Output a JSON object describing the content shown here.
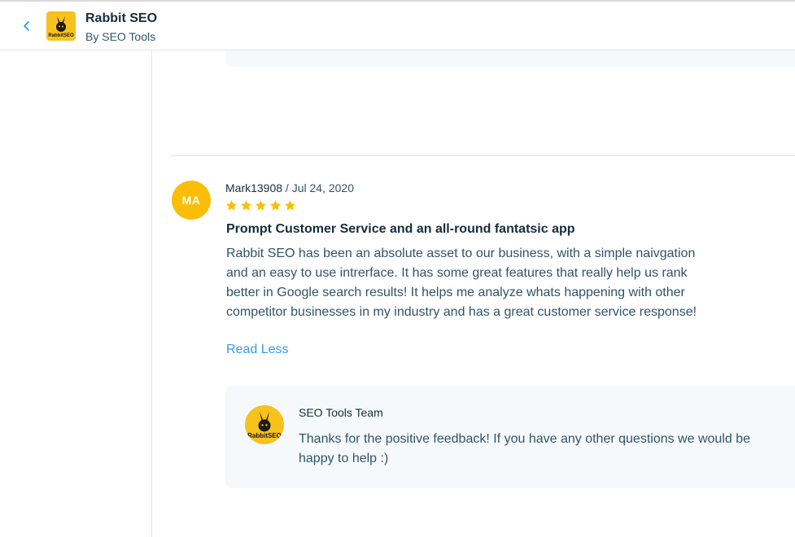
{
  "header": {
    "app_name": "Rabbit SEO",
    "vendor": "By SEO Tools",
    "logo_text": "RabbitSEO",
    "back_icon": "chevron-left-icon",
    "accent_color": "#3899ec"
  },
  "review": {
    "avatar_initials": "MA",
    "avatar_color": "#fbbd08",
    "author": "Mark13908",
    "separator": " / ",
    "date": "Jul 24, 2020",
    "rating": 5,
    "max_rating": 5,
    "title": "Prompt Customer Service and an all-round fantatsic app",
    "body": "Rabbit SEO has been an absolute asset to our business, with a simple naivgation and an easy to use intrerface. It has some great features that really help us rank better in Google search results! It helps me analyze whats happening with other competitor businesses in my industry and has a great customer service response!",
    "read_less": "Read Less"
  },
  "reply": {
    "author": "SEO Tools Team",
    "logo_text": "RabbitSEO",
    "text": "Thanks for the positive feedback! If you have any other questions we would be happy to help :)"
  }
}
